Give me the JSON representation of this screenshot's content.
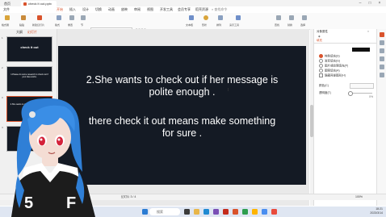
{
  "titlebar": {
    "home": "首页",
    "doc_tab": "check it out.pptx"
  },
  "menubar": {
    "file": "文件",
    "items": [
      "开始",
      "插入",
      "设计",
      "切换",
      "动画",
      "放映",
      "审阅",
      "视图",
      "开发工具",
      "会员专享",
      "稻壳资源"
    ],
    "active_index": 0,
    "search": "查找命令"
  },
  "ribbon": {
    "groups": [
      "格式刷",
      "粘贴",
      "新建幻灯片",
      "版式",
      "重置",
      "节",
      "字体",
      "段落",
      "文本框",
      "形状",
      "排列",
      "演示工具",
      "查找",
      "替换",
      "选择"
    ]
  },
  "leftpanel": {
    "tabs": [
      "大纲",
      "幻灯片"
    ],
    "slides": [
      {
        "num": "1",
        "text": "check it out"
      },
      {
        "num": "2",
        "text": "1.Please do some research to check out if your idea works."
      },
      {
        "num": "3",
        "text": "2.She wants to check out if her message is polite enough."
      },
      {
        "num": "4",
        "text": ""
      }
    ]
  },
  "slide": {
    "line1": "2.She wants to check out if her message is",
    "line2": "polite enough .",
    "line3": "there check it out means make something",
    "line4": "for sure ."
  },
  "rightpanel": {
    "title": "对象属性",
    "tab": "填充",
    "options": [
      "纯色填充(S)",
      "渐变填充(G)",
      "图片或纹理填充(P)",
      "图案填充(A)",
      "隐藏背景图形(H)"
    ],
    "selected_option": 0,
    "color_label": "颜色(C)",
    "transparency_label": "透明度(T)",
    "transparency_value": "0%",
    "apply_all": "全部应用",
    "reset": "重置背景"
  },
  "statusbar": {
    "page": "幻灯片 3 / 4",
    "zoom": "100%"
  },
  "taskbar": {
    "search": "搜索",
    "time": "18:21",
    "date": "2023/3/14"
  },
  "colors": {
    "accent": "#d9532c",
    "slide_bg": "#141a24"
  }
}
